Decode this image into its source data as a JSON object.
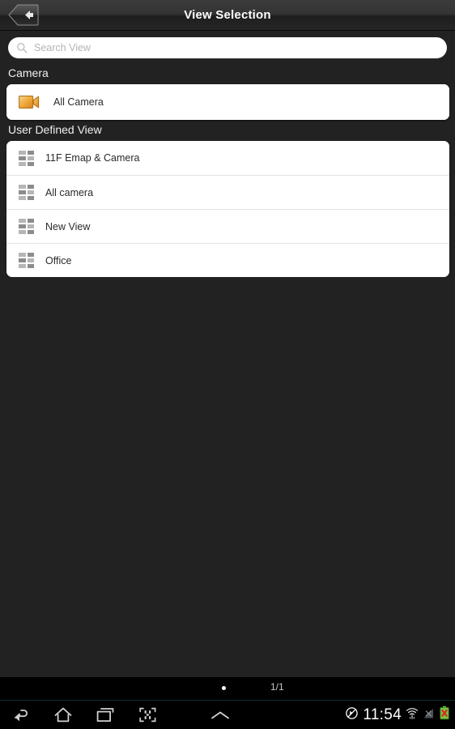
{
  "titlebar": {
    "title": "View Selection",
    "back_icon": "back-arrow-icon"
  },
  "search": {
    "placeholder": "Search View",
    "value": "",
    "icon": "search-icon"
  },
  "sections": [
    {
      "label": "Camera",
      "items": [
        {
          "label": "All Camera",
          "icon": "video-camera-icon"
        }
      ]
    },
    {
      "label": "User Defined View",
      "items": [
        {
          "label": "11F Emap & Camera",
          "icon": "grid-layout-icon"
        },
        {
          "label": "All camera",
          "icon": "grid-layout-icon"
        },
        {
          "label": "New View",
          "icon": "grid-layout-icon"
        },
        {
          "label": "Office",
          "icon": "grid-layout-icon"
        }
      ]
    }
  ],
  "pager": {
    "page_indicator": "1/1",
    "dot_icon": "page-dot-icon"
  },
  "system_bar": {
    "nav": [
      {
        "name": "back-icon"
      },
      {
        "name": "home-icon"
      },
      {
        "name": "recent-apps-icon"
      },
      {
        "name": "screenshot-icon"
      },
      {
        "name": "chevron-up-icon"
      }
    ],
    "clock": "11:54",
    "status_icons": [
      {
        "name": "mute-icon"
      },
      {
        "name": "wifi-icon"
      },
      {
        "name": "signal-icon"
      },
      {
        "name": "battery-error-icon"
      }
    ]
  },
  "colors": {
    "background": "#222222",
    "card": "#ffffff",
    "accent_orange": "#f0a030",
    "systembar": "#000000"
  }
}
